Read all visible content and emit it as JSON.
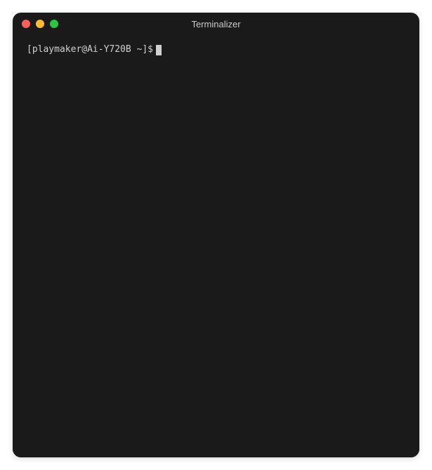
{
  "window": {
    "title": "Terminalizer"
  },
  "terminal": {
    "prompt": "[playmaker@Ai-Y720B ~]$"
  }
}
